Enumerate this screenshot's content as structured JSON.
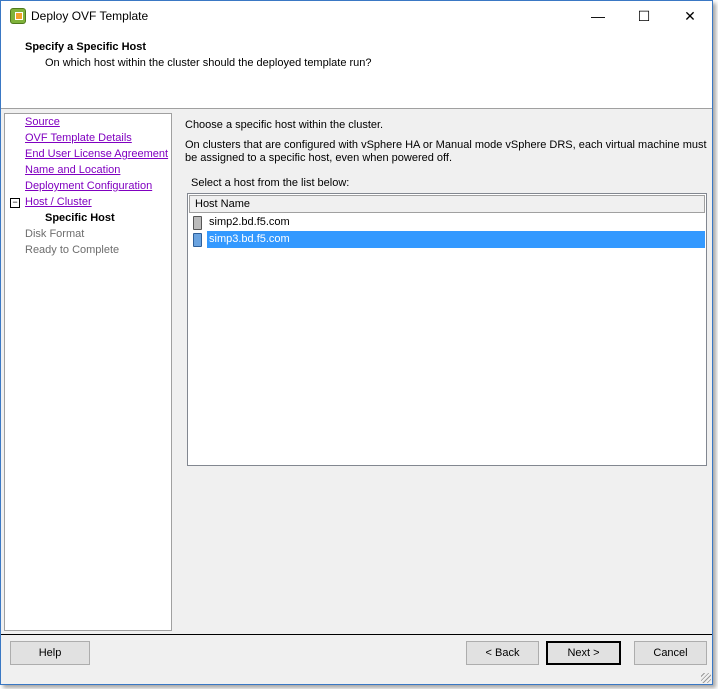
{
  "window": {
    "title": "Deploy OVF Template",
    "minimize": "—",
    "maximize": "☐",
    "close": "✕"
  },
  "header": {
    "title": "Specify a Specific Host",
    "subtitle": "On which host within the cluster should the deployed template run?"
  },
  "nav": [
    {
      "label": "Source",
      "state": "link"
    },
    {
      "label": "OVF Template Details",
      "state": "link"
    },
    {
      "label": "End User License Agreement",
      "state": "link"
    },
    {
      "label": "Name and Location",
      "state": "link"
    },
    {
      "label": "Deployment Configuration",
      "state": "link"
    },
    {
      "label": "Host / Cluster",
      "state": "link"
    },
    {
      "label": "Specific Host",
      "state": "current"
    },
    {
      "label": "Disk Format",
      "state": "disabled"
    },
    {
      "label": "Ready to Complete",
      "state": "disabled"
    }
  ],
  "content": {
    "intro": "Choose a specific host within the cluster.",
    "desc1": "On clusters that are configured with vSphere HA or Manual mode vSphere DRS, each virtual machine must",
    "desc2": "be assigned to a specific host, even when powered off.",
    "list_label": "Select a host from the list below:",
    "column": "Host Name",
    "hosts": [
      {
        "name": "simp2.bd.f5.com",
        "selected": false
      },
      {
        "name": "simp3.bd.f5.com",
        "selected": true
      }
    ]
  },
  "buttons": {
    "help": "Help",
    "back": "< Back",
    "next": "Next >",
    "cancel": "Cancel"
  },
  "colors": {
    "selection": "#3399ff",
    "link": "#8000c0",
    "border": "#3a78c4"
  }
}
